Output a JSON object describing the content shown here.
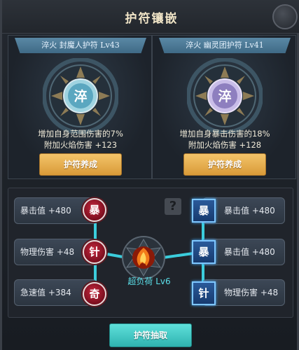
{
  "window": {
    "title": "护符镶嵌"
  },
  "cards": [
    {
      "name": "淬火 封魔人护符 Lv43",
      "glyph": "淬",
      "line1": "增加自身范围伤害的7%",
      "line2": "附加火焰伤害 +123",
      "button": "护符养成"
    },
    {
      "name": "淬火 幽灵团护符 Lv41",
      "glyph": "淬",
      "line1": "增加自身暴击伤害的18%",
      "line2": "附加火焰伤害 +128",
      "button": "护符养成"
    }
  ],
  "left_stats": [
    {
      "label": "暴击值 +480",
      "rune": "暴"
    },
    {
      "label": "物理伤害 +48",
      "rune": "针"
    },
    {
      "label": "急速值 +384",
      "rune": "奇"
    }
  ],
  "right_stats": [
    {
      "label": "暴击值 +480",
      "rune": "暴"
    },
    {
      "label": "暴击值 +480",
      "rune": "暴"
    },
    {
      "label": "物理伤害 +48",
      "rune": "针"
    }
  ],
  "core": {
    "label": "超负荷 Lv6"
  },
  "help": {
    "glyph": "?"
  },
  "draw_button": "护符抽取",
  "colors": {
    "accent_gold": "#e5ad4f",
    "accent_teal": "#3cc8c4",
    "rune_red": "#b31f35",
    "rune_blue": "#1f4c88",
    "link_cyan": "#3fe0f0"
  }
}
